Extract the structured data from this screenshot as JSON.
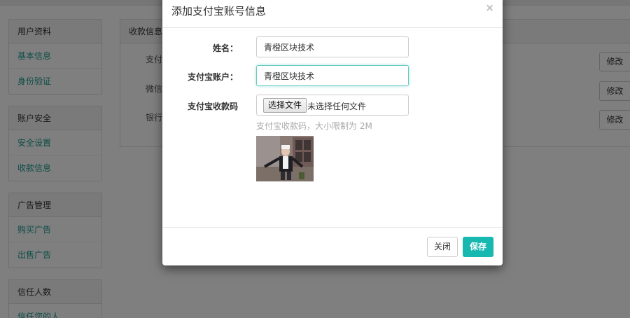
{
  "sidebar": {
    "sections": [
      {
        "title": "用户资料",
        "items": [
          "基本信息",
          "身份验证"
        ]
      },
      {
        "title": "账户安全",
        "items": [
          "安全设置",
          "收款信息"
        ]
      },
      {
        "title": "广告管理",
        "items": [
          "购买广告",
          "出售广告"
        ]
      },
      {
        "title": "信任人数",
        "items": [
          "信任您的人"
        ]
      }
    ]
  },
  "main": {
    "panel_title": "收款信息",
    "rows": [
      {
        "label": "支付宝",
        "edit_label": "修改"
      },
      {
        "label": "微信",
        "edit_label": "修改"
      },
      {
        "label": "银行卡",
        "edit_label": "修改"
      }
    ]
  },
  "modal": {
    "title": "添加支付宝账号信息",
    "close_glyph": "×",
    "fields": {
      "name": {
        "label": "姓名：",
        "value": "青橙区块技术"
      },
      "account": {
        "label": "支付宝账户：",
        "value": "青橙区块技术"
      },
      "qrcode": {
        "label": "支付宝收款码",
        "file_button": "选择文件",
        "file_status": "未选择任何文件",
        "help": "支付宝收款码，大小限制为 2M"
      }
    },
    "footer": {
      "close_label": "关闭",
      "save_label": "保存"
    }
  },
  "colors": {
    "accent": "#17b8b0",
    "link": "#1a9a8e"
  }
}
